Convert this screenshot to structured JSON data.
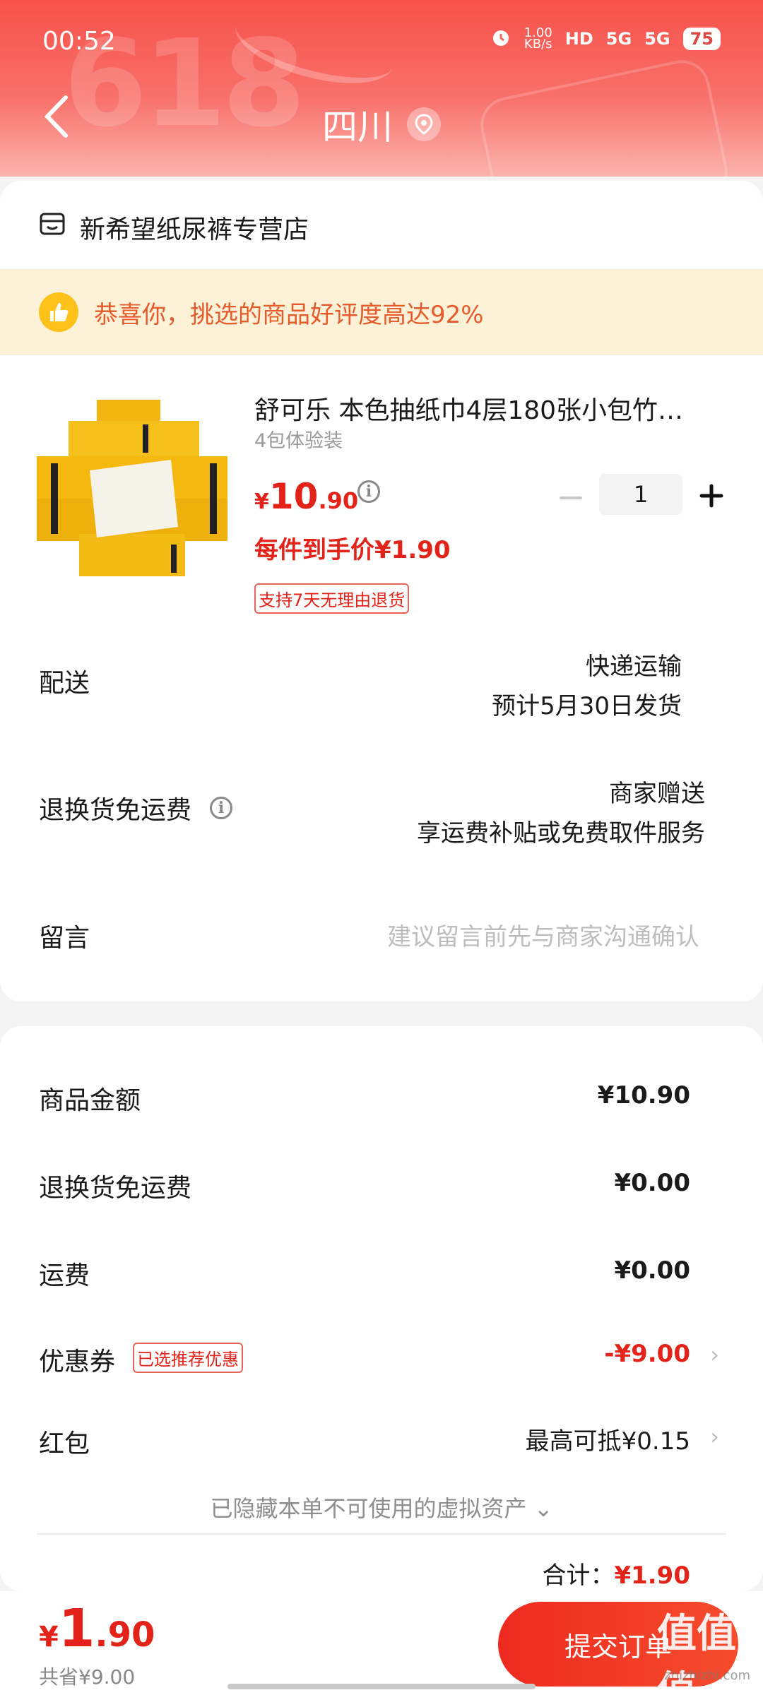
{
  "status_bar": {
    "time": "00:52",
    "net_speed_value": "1.00",
    "net_speed_unit": "KB/s",
    "hd_label": "HD",
    "signal1": "5G",
    "signal2": "5G",
    "battery": "75"
  },
  "header": {
    "location": "四川",
    "bg_text": "618"
  },
  "shop": {
    "name": "新希望纸尿裤专营店"
  },
  "praise": {
    "text": "恭喜你，挑选的商品好评度高达92%"
  },
  "product": {
    "title": "舒可乐 本色抽纸巾4层180张小包竹…",
    "spec": "4包体验装",
    "price_currency": "¥",
    "price_int": "10",
    "price_dec": ".90",
    "unit_price": "每件到手价¥1.90",
    "return_badge": "支持7天无理由退货",
    "quantity": "1"
  },
  "delivery": {
    "label": "配送",
    "method": "快递运输",
    "eta": "预计5月30日发货"
  },
  "return_shipping": {
    "label": "退换货免运费",
    "value": "商家赠送",
    "desc": "享运费补贴或免费取件服务"
  },
  "message": {
    "label": "留言",
    "placeholder": "建议留言前先与商家沟通确认"
  },
  "summary": {
    "goods_label": "商品金额",
    "goods_value": "¥10.90",
    "return_label": "退换货免运费",
    "return_value": "¥0.00",
    "shipping_label": "运费",
    "shipping_value": "¥0.00",
    "coupon_label": "优惠券",
    "coupon_badge": "已选推荐优惠",
    "coupon_value": "-¥9.00",
    "redpacket_label": "红包",
    "redpacket_value": "最高可抵¥0.15",
    "hidden_assets": "已隐藏本单不可使用的虚拟资产",
    "total_label": "合计：",
    "total_value": "¥1.90"
  },
  "bottom": {
    "currency": "¥",
    "price_int": "1",
    "price_dec": ".90",
    "saved": "共省¥9.00",
    "submit": "提交订单",
    "watermark": "zhizhizhi.com",
    "watermark_glyph": "值值值"
  },
  "colors": {
    "accent_red": "#e3231a",
    "header_red": "#f6524a",
    "praise_bg": "#fdf2d7",
    "praise_text": "#e55b2b"
  }
}
